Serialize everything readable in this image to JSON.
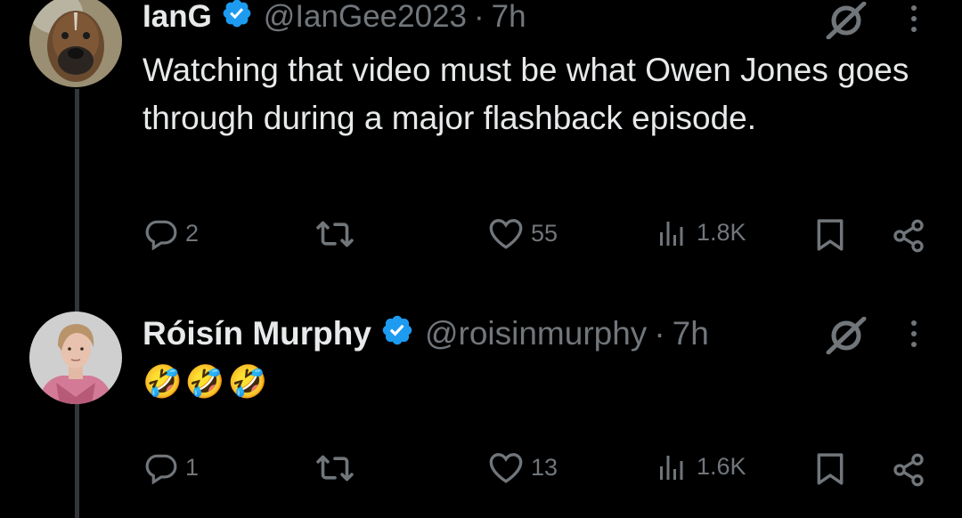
{
  "tweets": [
    {
      "name": "IanG",
      "handle": "@IanGee2023",
      "separator": "·",
      "time": "7h",
      "text": "Watching that video must be what Owen Jones goes through during a major flashback episode.",
      "replies": "2",
      "retweets": "",
      "likes": "55",
      "views": "1.8K",
      "avatar_icon": "boxer-dog-avatar"
    },
    {
      "name": "Róisín Murphy",
      "handle": "@roisinmurphy",
      "separator": "·",
      "time": "7h",
      "text_emoji": [
        "🤣",
        "🤣",
        "🤣"
      ],
      "replies": "1",
      "retweets": "",
      "likes": "13",
      "views": "1.6K",
      "avatar_icon": "person-portrait-avatar"
    }
  ],
  "colors": {
    "background": "#000000",
    "text": "#e7e9ea",
    "muted": "#71767b",
    "verified": "#1d9bf0",
    "thread_line": "#333639"
  }
}
